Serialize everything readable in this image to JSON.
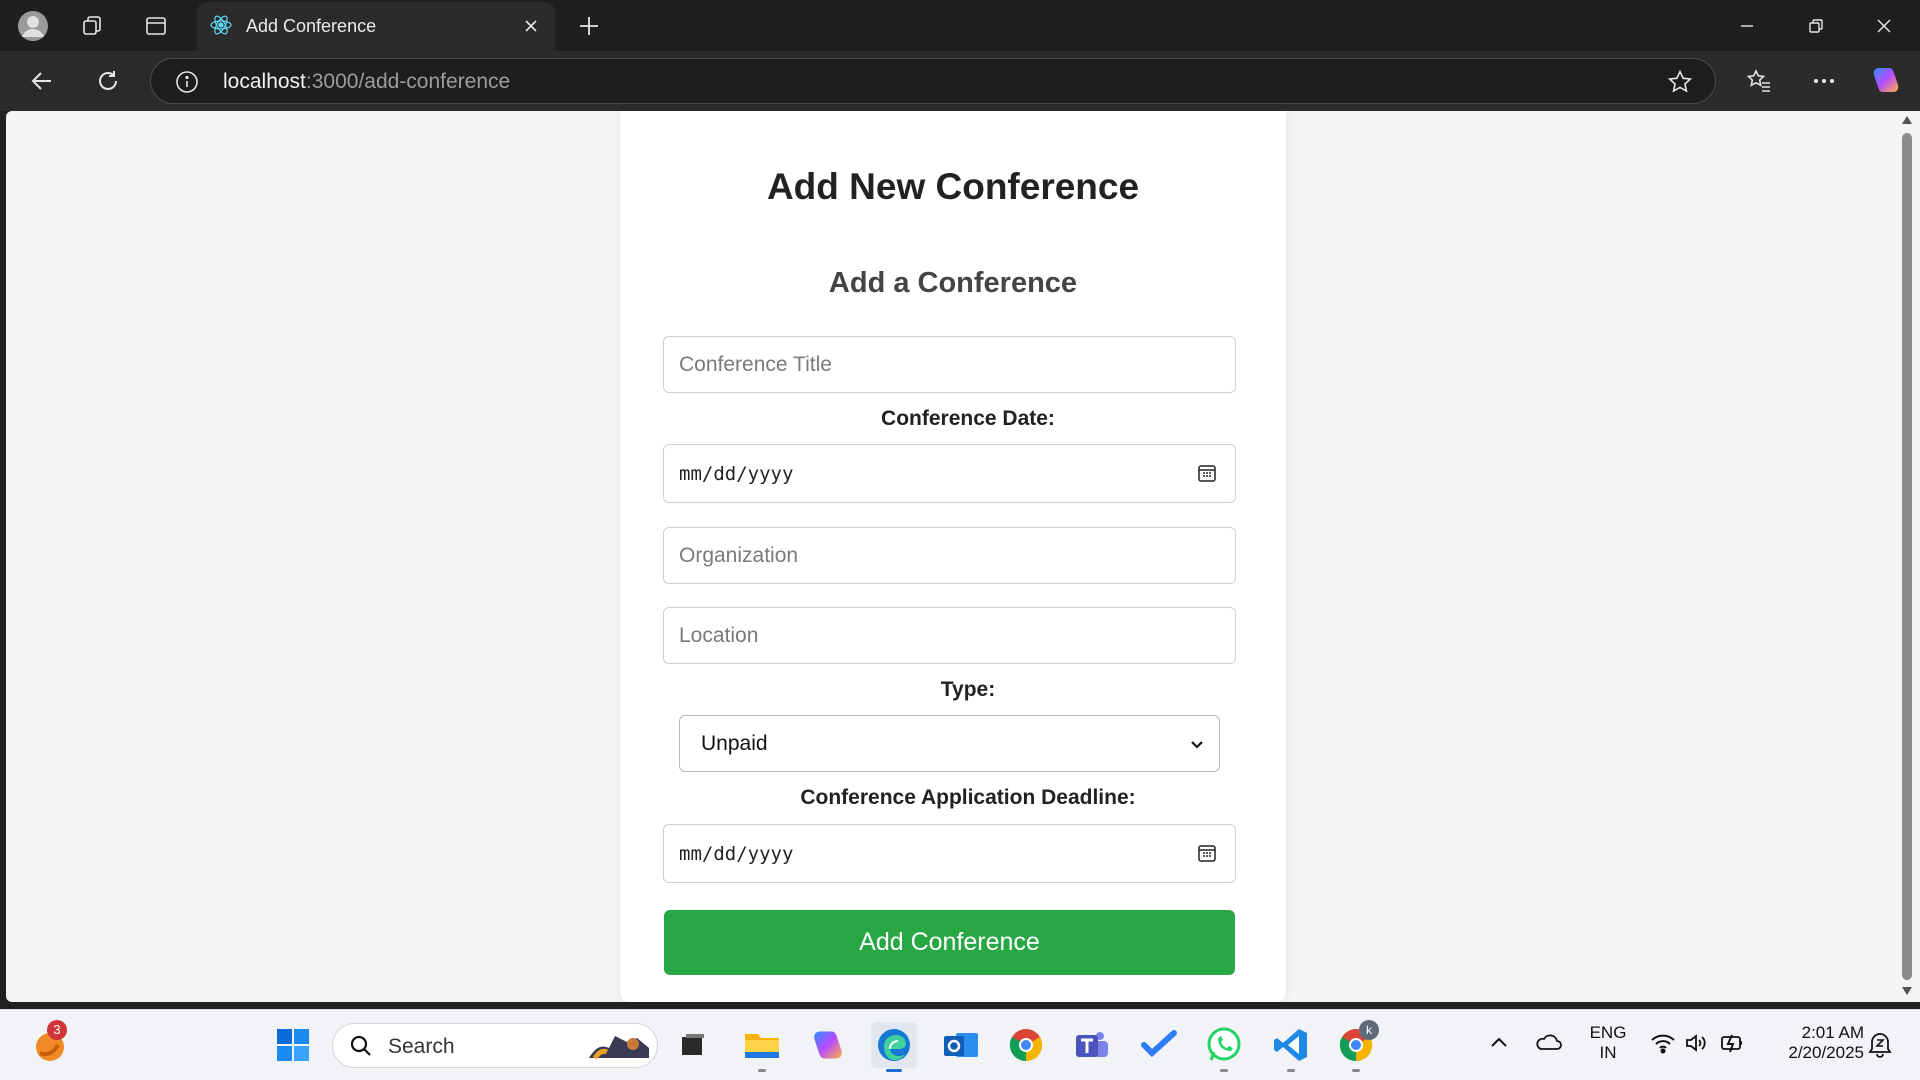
{
  "browser": {
    "tab_title": "Add Conference",
    "url_host": "localhost",
    "url_path": ":3000/add-conference"
  },
  "page": {
    "heading": "Add New Conference",
    "form_heading": "Add a Conference",
    "title_placeholder": "Conference Title",
    "date_label": "Conference Date:",
    "date_value": "mm/dd/yyyy",
    "organization_placeholder": "Organization",
    "location_placeholder": "Location",
    "type_label": "Type:",
    "type_selected": "Unpaid",
    "deadline_label": "Conference Application Deadline:",
    "deadline_value": "mm/dd/yyyy",
    "submit_label": "Add Conference"
  },
  "taskbar": {
    "widget_badge": "3",
    "search_label": "Search",
    "lang_top": "ENG",
    "lang_bottom": "IN",
    "time": "2:01 AM",
    "date": "2/20/2025",
    "chrome_profile": "k"
  },
  "colors": {
    "accent_green": "#28a745",
    "titlebar": "#1f1f1f",
    "toolbar": "#2b2b2b"
  }
}
